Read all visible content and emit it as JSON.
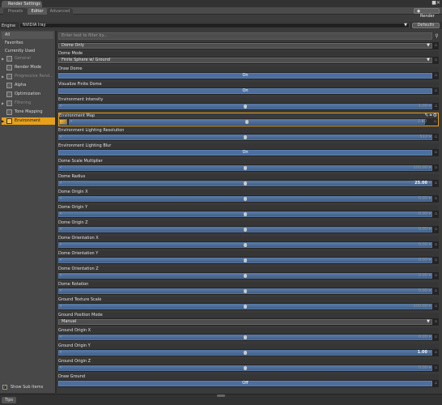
{
  "window": {
    "title": "Render Settings",
    "buttons": "■✕"
  },
  "tabs": [
    {
      "label": "Presets",
      "active": false
    },
    {
      "label": "Editor",
      "active": true
    },
    {
      "label": "Advanced",
      "active": false
    }
  ],
  "render_button": "Render",
  "engine": {
    "label": "Engine",
    "value": "NVIDIA Iray",
    "defaults_label": "Defaults"
  },
  "left": {
    "filters": [
      "All",
      "Favorites",
      "Currently Used"
    ],
    "tree": [
      {
        "label": "General",
        "dim": true,
        "expand": true
      },
      {
        "label": "Render Mode",
        "dim": false,
        "expand": false
      },
      {
        "label": "Progressive Rend...",
        "dim": true,
        "expand": true
      },
      {
        "label": "Alpha",
        "dim": false,
        "expand": false
      },
      {
        "label": "Optimization",
        "dim": false,
        "expand": false
      },
      {
        "label": "Filtering",
        "dim": true,
        "expand": true
      },
      {
        "label": "Tone Mapping",
        "dim": false,
        "expand": false
      },
      {
        "label": "Environment",
        "dim": false,
        "expand": true,
        "selected": true
      }
    ],
    "show_sub_items": "Show Sub Items"
  },
  "filter_placeholder": "Enter text to filter by...",
  "properties": [
    {
      "kind": "dropdown",
      "label": "",
      "value": "Dome Only"
    },
    {
      "kind": "dropdown",
      "label": "Dome Mode",
      "value": "Finite Sphere w/ Ground"
    },
    {
      "kind": "toggle",
      "label": "Draw Dome",
      "value": "On"
    },
    {
      "kind": "toggle",
      "label": "Visualize Finite Dome",
      "value": "On"
    },
    {
      "kind": "slider",
      "label": "Environment Intensity",
      "value": "1.00",
      "pos": 0.5
    },
    {
      "kind": "envmap",
      "label": "Environment Map",
      "value": "2.00",
      "pos": 0.5
    },
    {
      "kind": "slider",
      "label": "Environment Lighting Resolution",
      "value": "512",
      "pos": 0.5
    },
    {
      "kind": "toggle",
      "label": "Environment Lighting Blur",
      "value": "On"
    },
    {
      "kind": "slider",
      "label": "Dome Scale Multiplier",
      "value": "100.00",
      "pos": 0.5
    },
    {
      "kind": "slider",
      "label": "Dome Radius",
      "value": "25.00",
      "pos": 0.5,
      "bold": true
    },
    {
      "kind": "slider",
      "label": "Dome Origin X",
      "value": "0.00",
      "pos": 0.5
    },
    {
      "kind": "slider",
      "label": "Dome Origin Y",
      "value": "0.00",
      "pos": 0.5
    },
    {
      "kind": "slider",
      "label": "Dome Origin Z",
      "value": "0.00",
      "pos": 0.5
    },
    {
      "kind": "slider",
      "label": "Dome Orientation X",
      "value": "0.00",
      "pos": 0.5
    },
    {
      "kind": "slider",
      "label": "Dome Orientation Y",
      "value": "0.00",
      "pos": 0.5
    },
    {
      "kind": "slider",
      "label": "Dome Orientation Z",
      "value": "0.00",
      "pos": 0.5
    },
    {
      "kind": "slider",
      "label": "Dome Rotation",
      "value": "0.00",
      "pos": 0.5
    },
    {
      "kind": "slider",
      "label": "Ground Texture Scale",
      "value": "100.00",
      "pos": 0.5
    },
    {
      "kind": "dropdown",
      "label": "Ground Position Mode",
      "value": "Manual"
    },
    {
      "kind": "slider",
      "label": "Ground Origin X",
      "value": "0.00",
      "pos": 0.5
    },
    {
      "kind": "slider",
      "label": "Ground Origin Y",
      "value": "1.00",
      "pos": 0.5,
      "bold": true
    },
    {
      "kind": "slider",
      "label": "Ground Origin Z",
      "value": "0.00",
      "pos": 0.5
    },
    {
      "kind": "toggle",
      "label": "Draw Ground",
      "value": "Off"
    }
  ],
  "footer": {
    "tips": "Tips"
  },
  "colors": {
    "accent": "#e6a01a",
    "slider": "#4c6f9f"
  },
  "icons": {
    "render": "camera-icon",
    "search": "search-icon",
    "envmap_actions": [
      "edit-icon",
      "link-icon",
      "gear-icon"
    ]
  }
}
